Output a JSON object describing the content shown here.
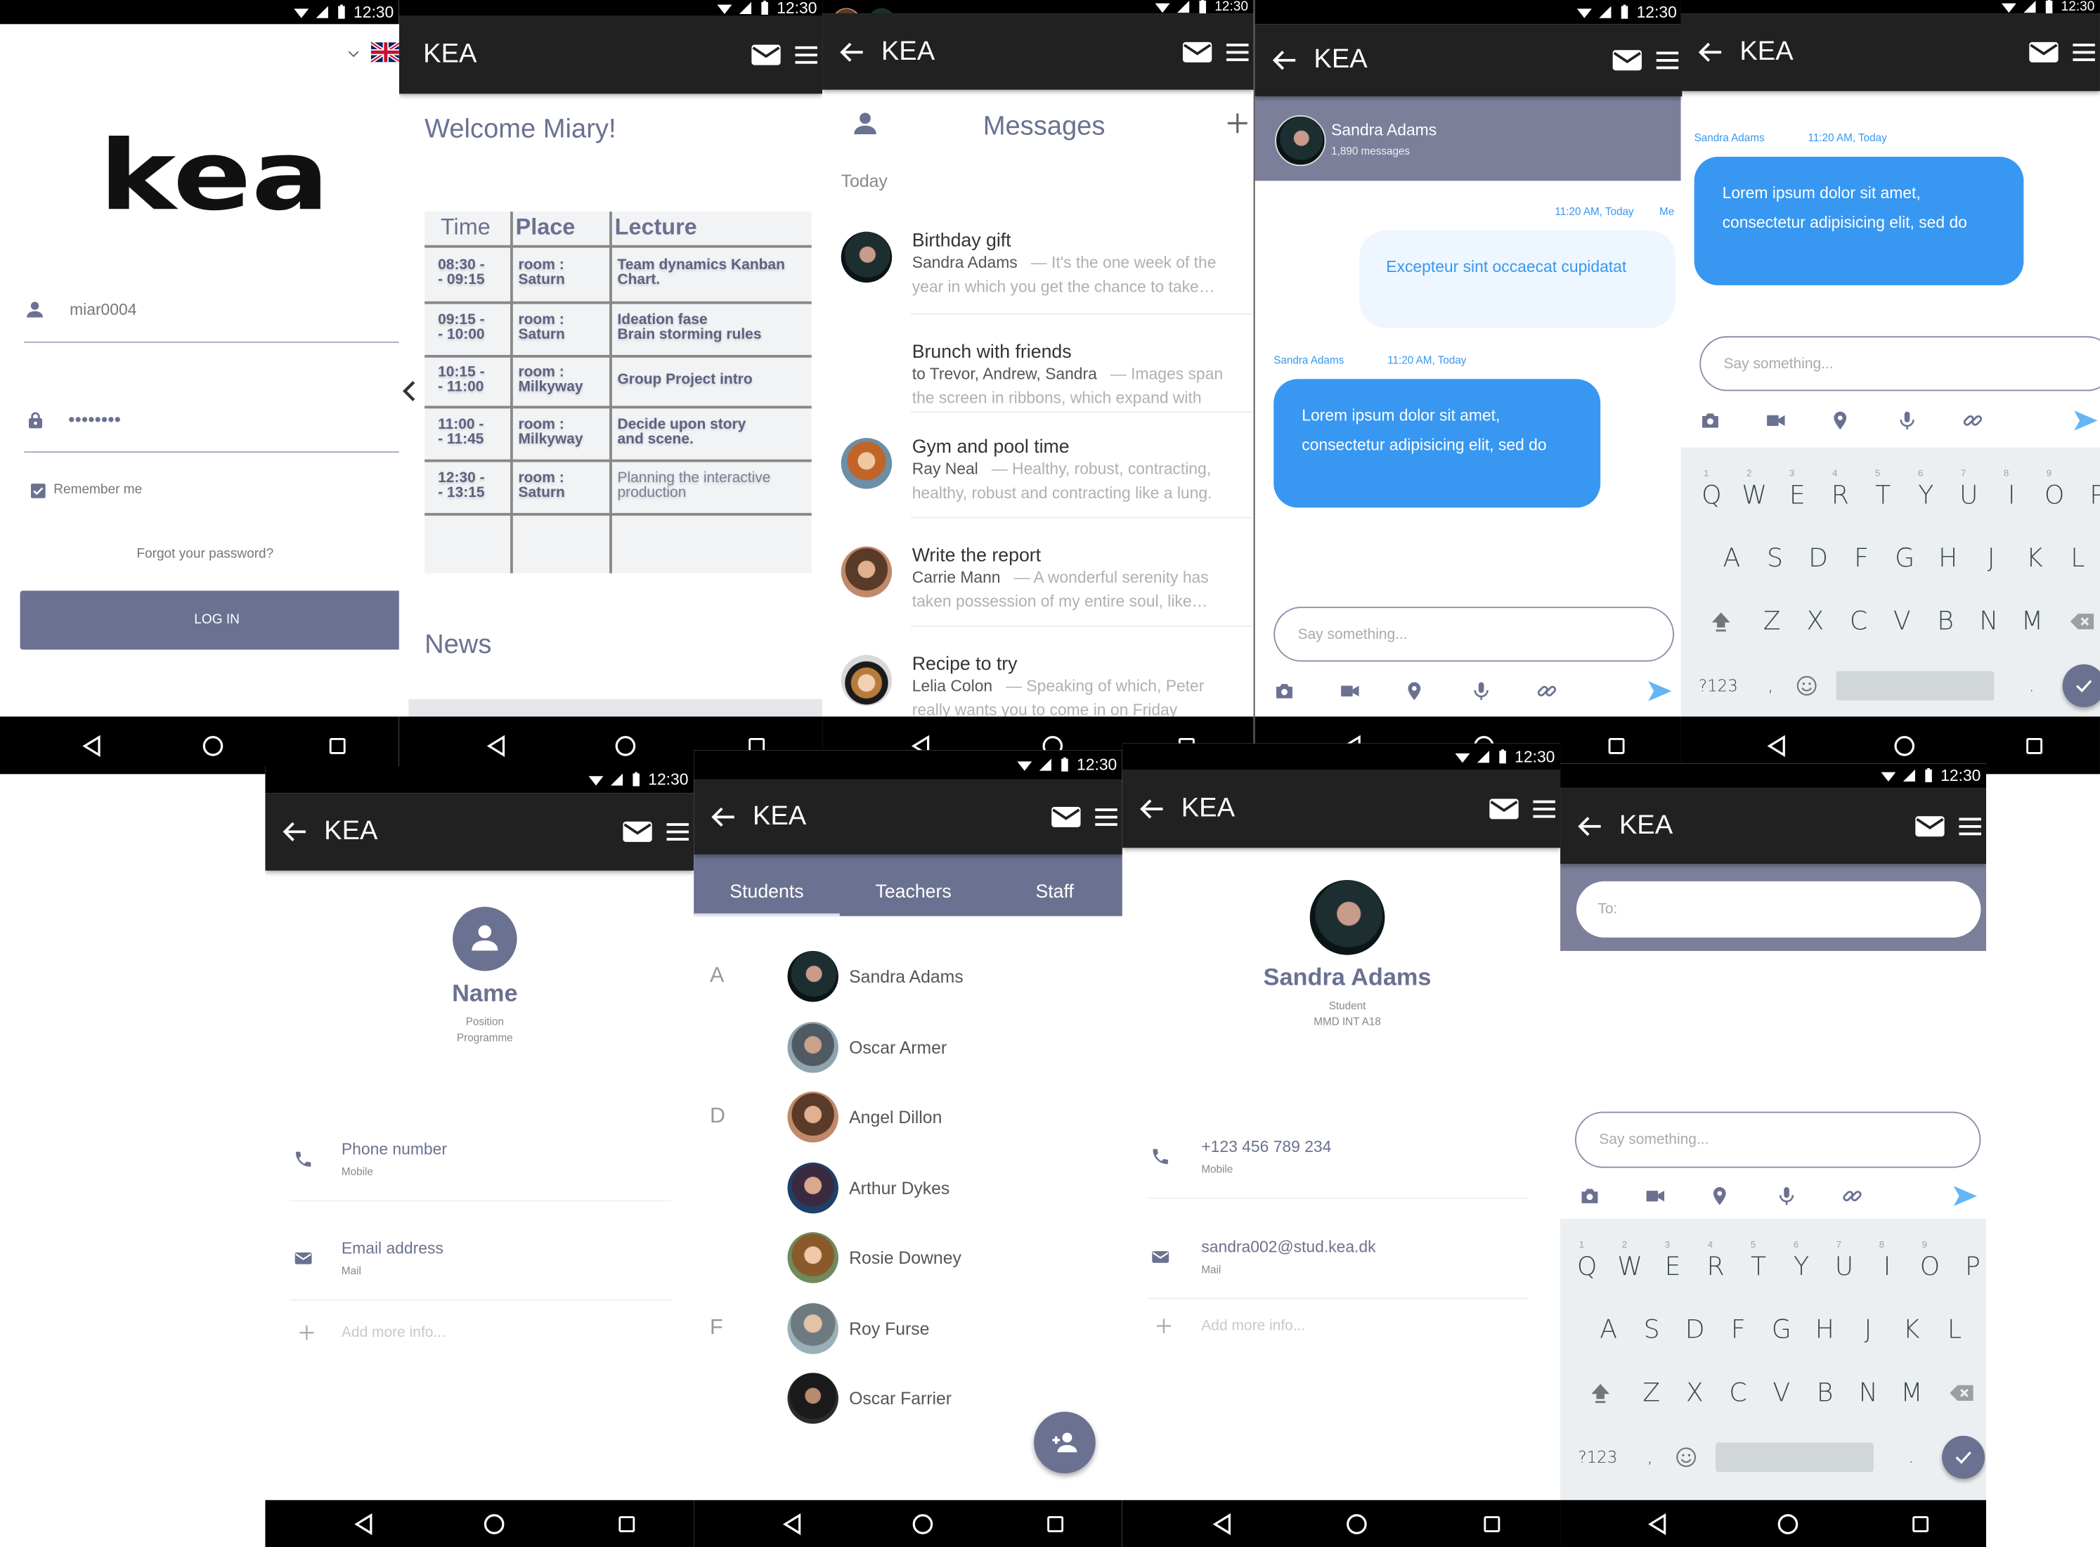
{
  "status": {
    "time": "12:30"
  },
  "app": {
    "title": "KEA"
  },
  "colors": {
    "dark_bar": "#212121",
    "accent": "#6b7190",
    "header_gray": "#7c7f9a",
    "chat_blue": "#3897f0",
    "bubble_light": "#eef6ff",
    "keyboard": "#eceff1"
  },
  "login": {
    "language_icon": "uk-flag-icon",
    "logo": "kea",
    "username": "miar0004",
    "password": "••••••••",
    "remember_label": "Remember me",
    "remember_checked": true,
    "forgot": "Forgot your password?",
    "login_button": "LOG IN"
  },
  "home": {
    "welcome": "Welcome Miary!",
    "table": {
      "headers": [
        "Time",
        "Place",
        "Lecture"
      ],
      "rows": [
        [
          "08:30 -\n- 09:15",
          "room :\nSaturn",
          "Team dynamics Kanban\nChart."
        ],
        [
          "09:15 -\n- 10:00",
          "room :\nSaturn",
          "Ideation fase\nBrain storming rules"
        ],
        [
          "10:15 -\n- 11:00",
          "room :\nMilkyway",
          "Group Project intro"
        ],
        [
          "11:00 -\n- 11:45",
          "room :\nMilkyway",
          "Decide upon story\nand scene."
        ],
        [
          "12:30 -\n- 13:15",
          "room :\nSaturn",
          "Planning the interactive\nproduction"
        ]
      ]
    },
    "news": "News"
  },
  "messages": {
    "title": "Messages",
    "section": "Today",
    "items": [
      {
        "title": "Birthday gift",
        "from": "Sandra Adams",
        "preview": "— It's the one week of the year in which you get the chance to take…"
      },
      {
        "title": "Brunch with friends",
        "from": "to Trevor, Andrew, Sandra",
        "preview": "— Images span the screen in ribbons, which expand with"
      },
      {
        "title": "Gym and pool time",
        "from": "Ray Neal",
        "preview": "— Healthy, robust, contracting, healthy, robust and contracting like a lung."
      },
      {
        "title": "Write the report",
        "from": "Carrie Mann",
        "preview": "— A wonderful serenity has taken possession of my entire soul, like…"
      },
      {
        "title": "Recipe to try",
        "from": "Lelia Colon",
        "preview": "— Speaking of which, Peter really wants you to come in on Friday"
      }
    ]
  },
  "chat": {
    "contact": "Sandra Adams",
    "count": "1,890 messages",
    "me_time": "11:20 AM, Today",
    "me_label": "Me",
    "me_message": "Excepteur sint occaecat cupidatat",
    "them_name": "Sandra Adams",
    "them_time": "11:20 AM, Today",
    "them_message_1": "Lorem ipsum dolor sit amet,",
    "them_message_2": "consectetur adipisicing elit, sed do",
    "input_placeholder": "Say something..."
  },
  "keyboard": {
    "row1": [
      "Q",
      "W",
      "E",
      "R",
      "T",
      "Y",
      "U",
      "I",
      "O",
      "P"
    ],
    "hints": [
      "1",
      "2",
      "3",
      "4",
      "5",
      "6",
      "7",
      "8",
      "9"
    ],
    "row2": [
      "A",
      "S",
      "D",
      "F",
      "G",
      "H",
      "J",
      "K",
      "L"
    ],
    "row3": [
      "Z",
      "X",
      "C",
      "V",
      "B",
      "N",
      "M"
    ],
    "symbols": "?123",
    "comma": ",",
    "period": "."
  },
  "profile_blank": {
    "name": "Name",
    "position": "Position",
    "programme": "Programme",
    "phone": "Phone number",
    "phone_type": "Mobile",
    "email": "Email address",
    "email_type": "Mail",
    "add_more": "Add more info..."
  },
  "contacts": {
    "tabs": [
      "Students",
      "Teachers",
      "Staff"
    ],
    "active_tab": "Students",
    "people": [
      {
        "letter": "A",
        "name": "Sandra Adams"
      },
      {
        "letter": "",
        "name": "Oscar Armer"
      },
      {
        "letter": "D",
        "name": "Angel Dillon"
      },
      {
        "letter": "",
        "name": "Arthur Dykes"
      },
      {
        "letter": "",
        "name": "Rosie Downey"
      },
      {
        "letter": "F",
        "name": "Roy Furse"
      },
      {
        "letter": "",
        "name": "Oscar Farrier"
      }
    ]
  },
  "profile_sandra": {
    "name": "Sandra Adams",
    "position": "Student",
    "programme": "MMD INT A18",
    "phone": "+123 456 789 234",
    "phone_type": "Mobile",
    "email": "sandra002@stud.kea.dk",
    "email_type": "Mail",
    "add_more": "Add more info..."
  },
  "new_message": {
    "to_placeholder": "To:",
    "input_placeholder": "Say something..."
  }
}
